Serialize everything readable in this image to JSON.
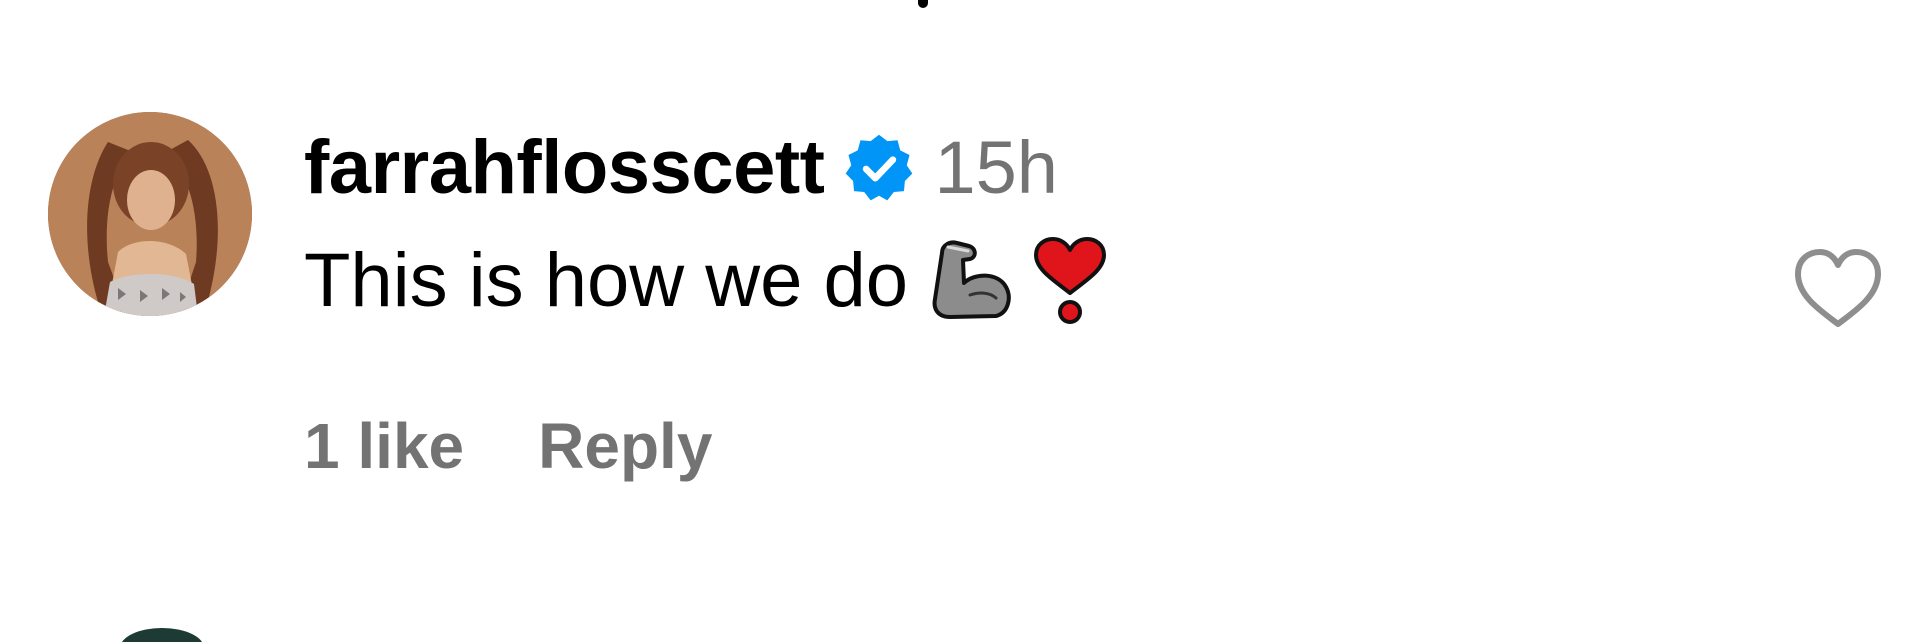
{
  "comment": {
    "username": "farrahflosscett",
    "verified": true,
    "timestamp": "15h",
    "text": "This is how we do",
    "emojis": [
      "flexed-biceps-emoji",
      "heavy-heart-exclamation-emoji"
    ],
    "likes_label": "1 like",
    "reply_label": "Reply"
  },
  "colors": {
    "text": "#000000",
    "muted": "#737373",
    "verified_blue": "#0095F6",
    "heart_outline": "#8E8E8E",
    "emoji_red": "#E0151B",
    "emoji_gray": "#8A8A8A"
  },
  "icons": {
    "verified": "verified-badge-icon",
    "like": "heart-outline-icon"
  }
}
